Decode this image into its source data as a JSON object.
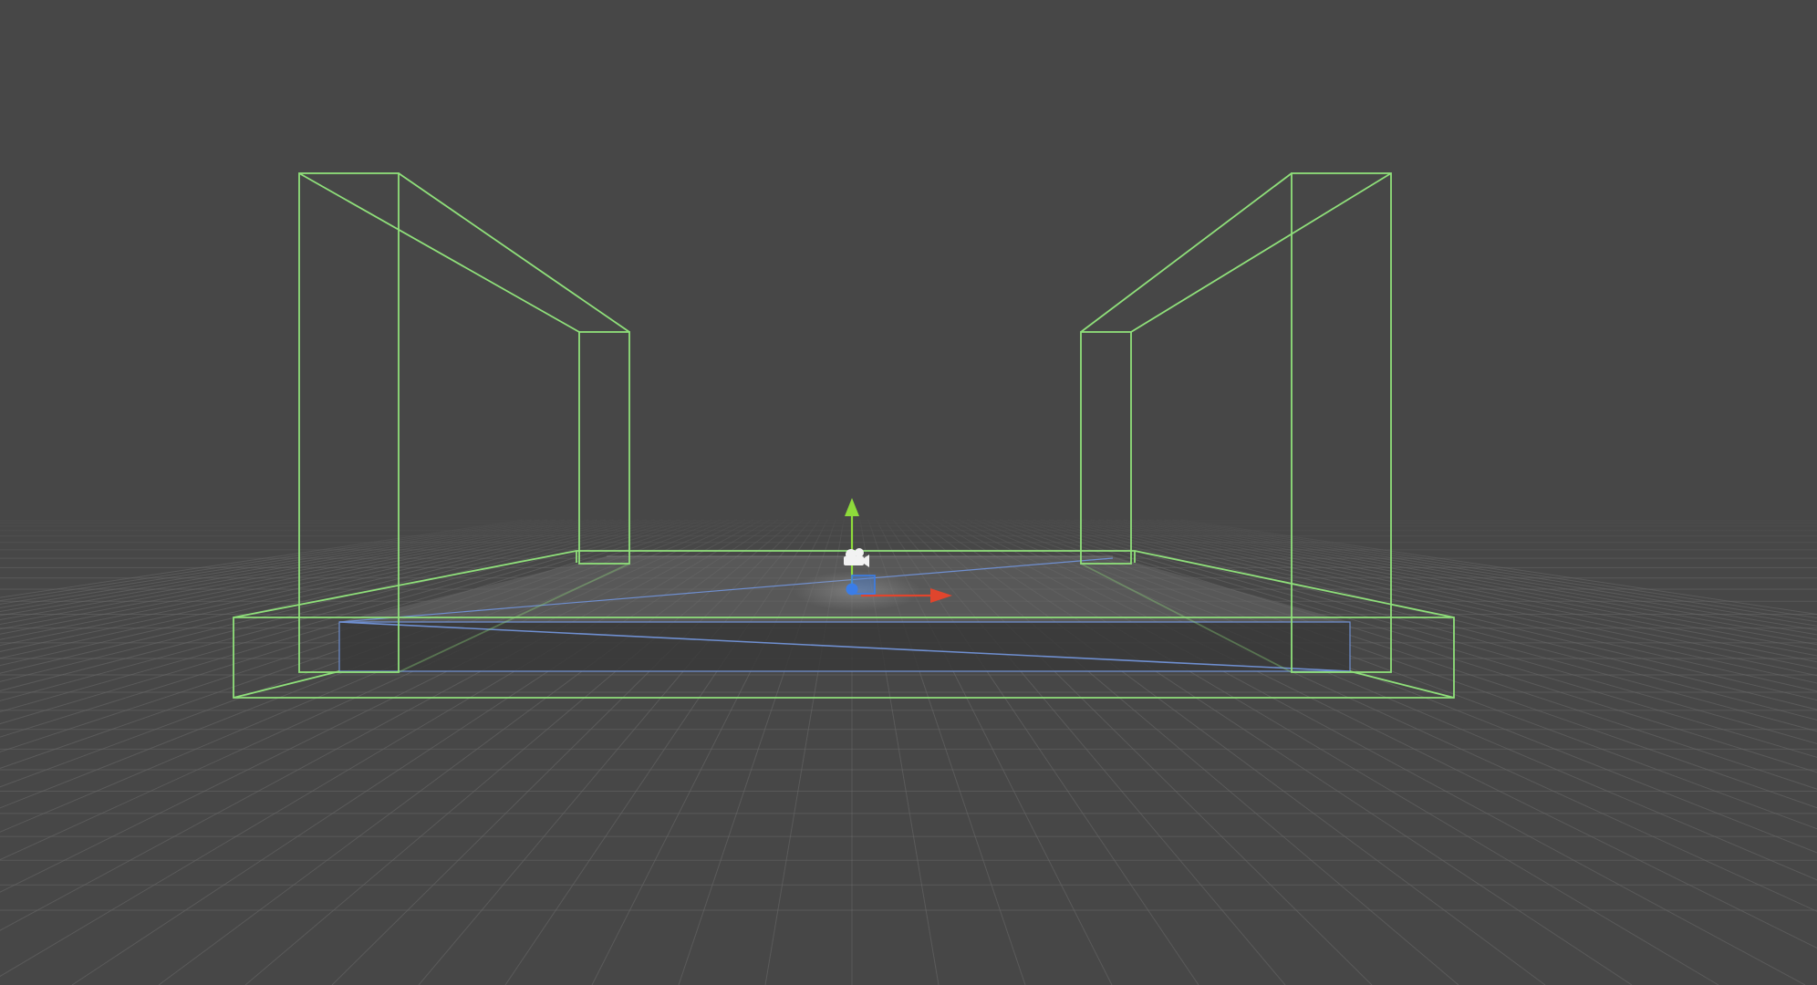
{
  "scene": {
    "view": "scene-view",
    "background_color": "#474747",
    "grid": {
      "enabled": true,
      "line_color": "#6a6a6a",
      "style": "perspective-floor-grid"
    },
    "wireframes": {
      "collider_color": "#8fe07a",
      "mesh_edge_color": "#6f8fd0",
      "objects": [
        "left-wall-collider",
        "right-wall-collider",
        "floor-collider",
        "floor-platform-mesh"
      ]
    },
    "gizmo": {
      "x_axis_color": "#e0452d",
      "y_axis_color": "#8edb3b",
      "z_axis_color": "#3a7de8",
      "camera_icon": "camera-icon"
    }
  }
}
